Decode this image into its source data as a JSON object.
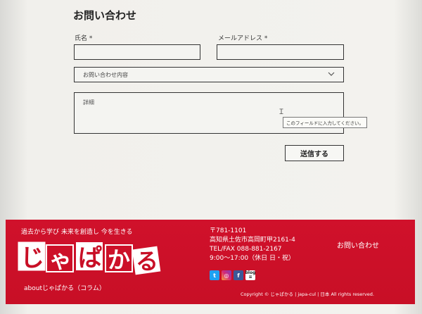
{
  "form": {
    "title": "お問い合わせ",
    "name_label": "氏名 *",
    "email_label": "メールアドレス *",
    "inquiry_select": "お問い合わせ内容",
    "details_placeholder": "詳細",
    "tooltip": "このフィールドに入力してください。",
    "submit_label": "送信する"
  },
  "footer": {
    "tagline": "過去から学び 未来を創造し 今を生きる",
    "logo_text": "じゃぱかる",
    "about_link": "aboutじゃぱかる（コラム）",
    "address": {
      "postal": "〒781-1101",
      "street": "高知県土佐市高岡町甲2161-4",
      "phone": "TEL/FAX 088-881-2167",
      "hours": "9:00～17:00（休日  日・祝）"
    },
    "contact_link": "お問い合わせ",
    "copyright": "Copyright ©   じゃぱかる | japa-cul | 日本   All rights reserved.",
    "social": [
      "twitter-icon",
      "instagram-icon",
      "facebook-icon",
      "blog-icon"
    ],
    "blog_label": "blog"
  },
  "colors": {
    "footer_red": "#c80f26",
    "background": "#f1f0ec"
  }
}
